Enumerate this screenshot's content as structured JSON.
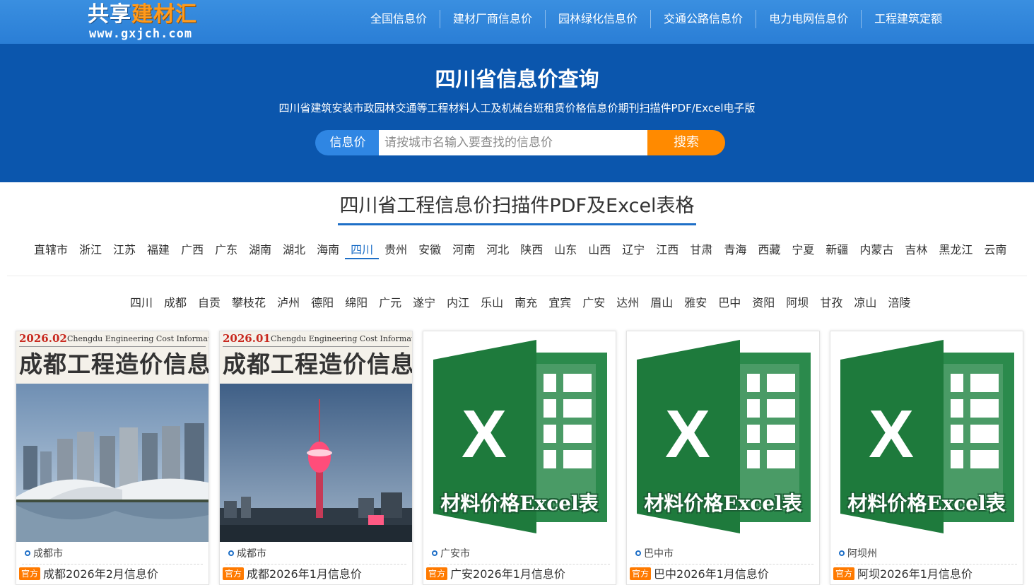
{
  "logo": {
    "part1": "共享",
    "part2": "建材汇",
    "domain": "www.gxjch.com"
  },
  "nav": [
    "全国信息价",
    "建材厂商信息价",
    "园林绿化信息价",
    "交通公路信息价",
    "电力电网信息价",
    "工程建筑定额"
  ],
  "hero": {
    "title": "四川省信息价查询",
    "subtitle": "四川省建筑安装市政园林交通等工程材料人工及机械台班租赁价格信息价期刊扫描件PDF/Excel电子版",
    "search_tag": "信息价",
    "search_placeholder": "请按城市名输入要查找的信息价",
    "search_button": "搜索"
  },
  "section_title": "四川省工程信息价扫描件PDF及Excel表格",
  "provinces": [
    "直辖市",
    "浙江",
    "江苏",
    "福建",
    "广西",
    "广东",
    "湖南",
    "湖北",
    "海南",
    "四川",
    "贵州",
    "安徽",
    "河南",
    "河北",
    "陕西",
    "山东",
    "山西",
    "辽宁",
    "江西",
    "甘肃",
    "青海",
    "西藏",
    "宁夏",
    "新疆",
    "内蒙古",
    "吉林",
    "黑龙江",
    "云南"
  ],
  "active_province": "四川",
  "cities": [
    "四川",
    "成都",
    "自贡",
    "攀枝花",
    "泸州",
    "德阳",
    "绵阳",
    "广元",
    "遂宁",
    "内江",
    "乐山",
    "南充",
    "宜宾",
    "广安",
    "达州",
    "眉山",
    "雅安",
    "巴中",
    "资阳",
    "阿坝",
    "甘孜",
    "凉山",
    "涪陵"
  ],
  "badge": "官方",
  "cards": [
    {
      "type": "magazine",
      "date": "2026.02",
      "en": "Chengdu Engineering Cost Information",
      "cn": "成都工程造价信息",
      "location": "成都市",
      "name": "成都2026年2月信息价"
    },
    {
      "type": "magazine",
      "date": "2026.01",
      "en": "Chengdu Engineering Cost Information",
      "cn": "成都工程造价信息",
      "location": "成都市",
      "name": "成都2026年1月信息价"
    },
    {
      "type": "excel",
      "label": "材料价格Excel表",
      "location": "广安市",
      "name": "广安2026年1月信息价"
    },
    {
      "type": "excel",
      "label": "材料价格Excel表",
      "location": "巴中市",
      "name": "巴中2026年1月信息价"
    },
    {
      "type": "excel",
      "label": "材料价格Excel表",
      "location": "阿坝州",
      "name": "阿坝2026年1月信息价"
    }
  ],
  "colors": {
    "nav_bg": "#2a7ed6",
    "hero_bg": "#0b56ad",
    "accent": "#1e6fc7",
    "orange": "#ff8a00",
    "excel_green": "#1e7a3c"
  }
}
